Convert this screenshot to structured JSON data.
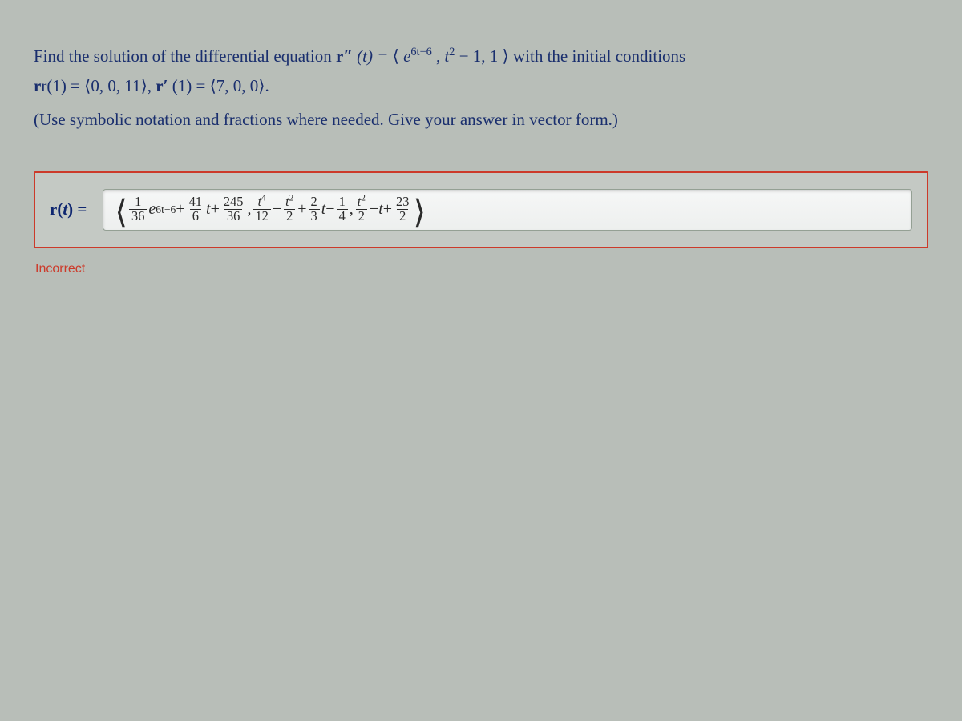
{
  "problem": {
    "line1_prefix": "Find the solution of the differential equation ",
    "r2": "r″",
    "of_t_eq": "(t) = ",
    "lang": "⟨",
    "rang": "⟩",
    "e_part": "e",
    "e_exp": "6t−6",
    "comma": ", ",
    "t2": "t",
    "t2_exp": "2",
    "minus1": " − 1, 1",
    "line1_suffix": " with the initial conditions",
    "line2_prefix": "",
    "r_of1": "r(1) = ⟨0, 0, 11⟩, ",
    "rprime": "r′",
    "rprime_of1": "(1) = ⟨7, 0, 0⟩.",
    "instructions": "(Use symbolic notation and fractions where needed. Give your answer in vector form.)"
  },
  "answer": {
    "label": "r(t) = ",
    "open": "⟨",
    "close": "⟩",
    "c1": {
      "f1_num": "1",
      "f1_den": "36",
      "e": "e",
      "e_exp": "6t−6",
      "plus1": " + ",
      "f2_num": "41",
      "f2_den": "6",
      "t": "t",
      "plus2": " + ",
      "f3_num": "245",
      "f3_den": "36"
    },
    "sep1": " , ",
    "c2": {
      "f1_num": "t",
      "f1_num_exp": "4",
      "f1_den": "12",
      "minus1": " − ",
      "f2_num": "t",
      "f2_num_exp": "2",
      "f2_den": "2",
      "plus1": " + ",
      "f3_num": "2",
      "f3_den": "3",
      "t": "t",
      "minus2": " − ",
      "f4_num": "1",
      "f4_den": "4"
    },
    "sep2": " , ",
    "c3": {
      "f1_num": "t",
      "f1_num_exp": "2",
      "f1_den": "2",
      "minus1": " − ",
      "t": "t",
      "plus1": " + ",
      "f2_num": "23",
      "f2_den": "2"
    }
  },
  "feedback": "Incorrect"
}
